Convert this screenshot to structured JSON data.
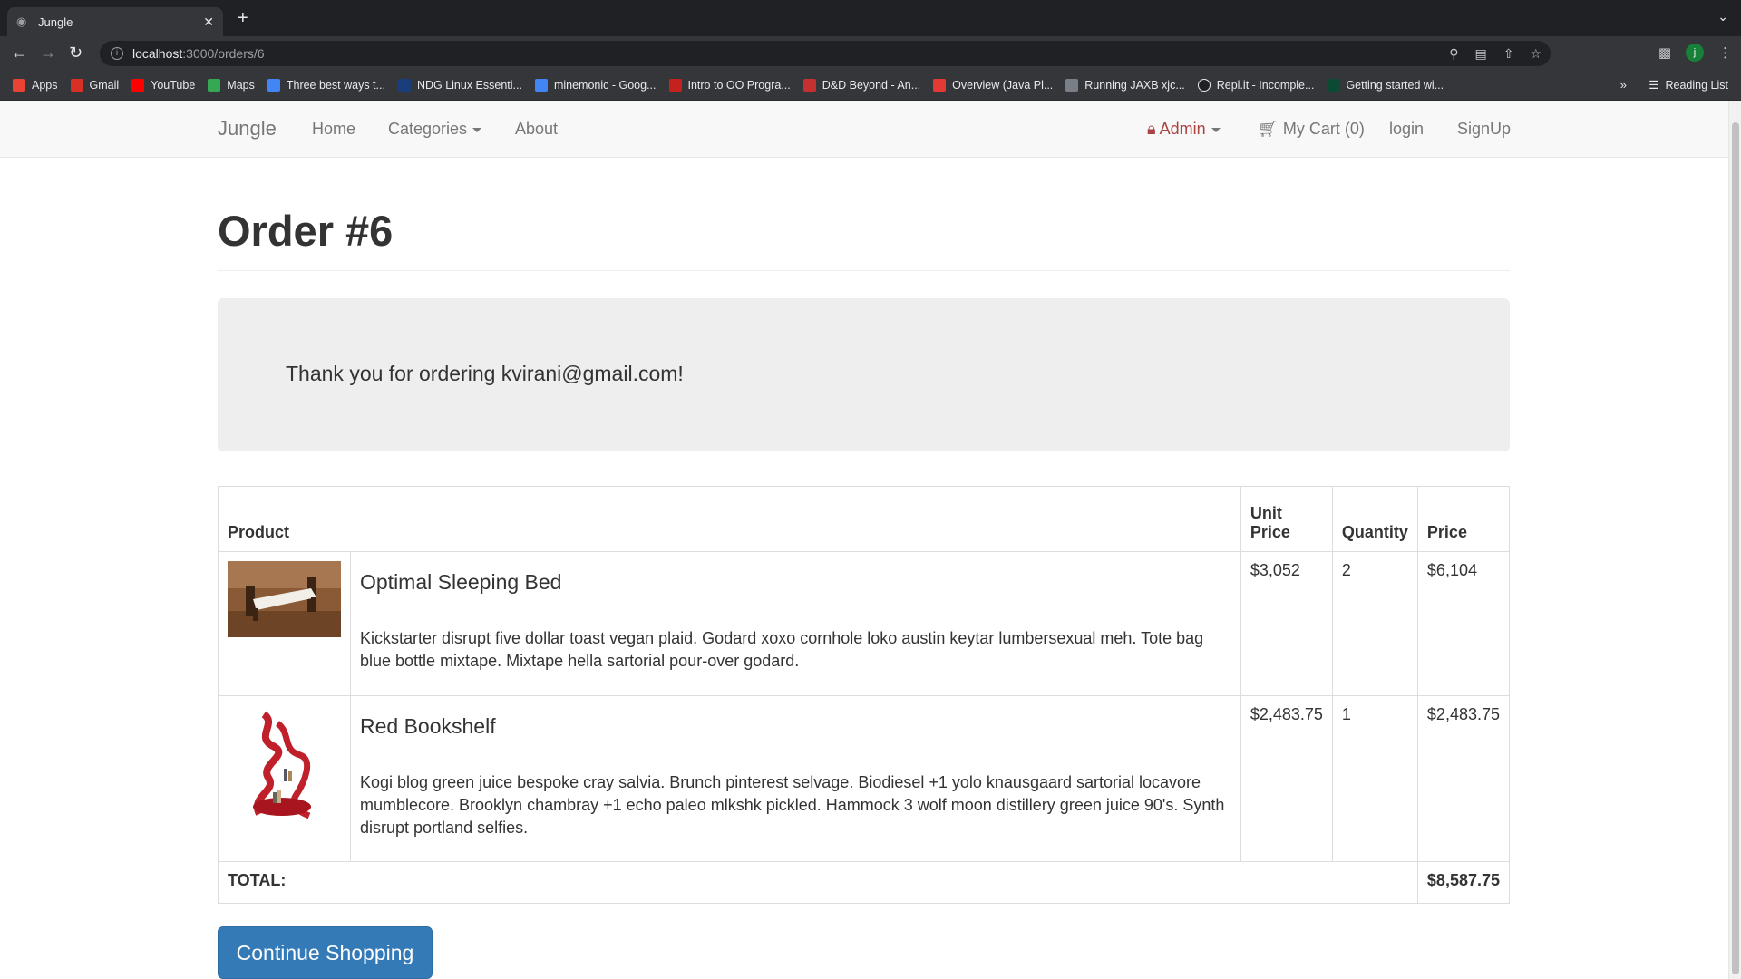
{
  "browser": {
    "tab_title": "Jungle",
    "url_host": "localhost",
    "url_path": ":3000/orders/6",
    "profile_initial": "j",
    "bookmarks": [
      {
        "label": "Apps",
        "icon": "apps-grid-icon",
        "color": "#ea4335"
      },
      {
        "label": "Gmail",
        "icon": "gmail-icon",
        "color": "#d93025"
      },
      {
        "label": "YouTube",
        "icon": "youtube-icon",
        "color": "#ff0000"
      },
      {
        "label": "Maps",
        "icon": "maps-icon",
        "color": "#34a853"
      },
      {
        "label": "Three best ways t...",
        "icon": "docs-icon",
        "color": "#4285f4"
      },
      {
        "label": "NDG Linux Essenti...",
        "icon": "ndg-icon",
        "color": "#1a3d7c"
      },
      {
        "label": "minemonic - Goog...",
        "icon": "docs-icon",
        "color": "#4285f4"
      },
      {
        "label": "Intro to OO Progra...",
        "icon": "course-icon",
        "color": "#c5221f"
      },
      {
        "label": "D&D Beyond - An...",
        "icon": "dndbeyond-icon",
        "color": "#c53131"
      },
      {
        "label": "Overview (Java Pl...",
        "icon": "oracle-icon",
        "color": "#e53935"
      },
      {
        "label": "Running JAXB xjc...",
        "icon": "globe-icon",
        "color": "#7a7f87"
      },
      {
        "label": "Repl.it - Incomple...",
        "icon": "replit-icon",
        "color": "#ffffff"
      },
      {
        "label": "Getting started wi...",
        "icon": "django-icon",
        "color": "#0c4b33"
      }
    ],
    "reading_list": "Reading List"
  },
  "navbar": {
    "brand": "Jungle",
    "home": "Home",
    "categories": "Categories",
    "about": "About",
    "admin": "Admin",
    "cart": "My Cart (0)",
    "login": "login",
    "signup": "SignUp"
  },
  "page": {
    "title": "Order #6",
    "thank_you": "Thank you for ordering kvirani@gmail.com!",
    "continue_button": "Continue Shopping"
  },
  "table": {
    "headers": {
      "product": "Product",
      "unit_price": "Unit Price",
      "quantity": "Quantity",
      "price": "Price"
    },
    "items": [
      {
        "name": "Optimal Sleeping Bed",
        "description": "Kickstarter disrupt five dollar toast vegan plaid. Godard xoxo cornhole loko austin keytar lumbersexual meh. Tote bag blue bottle mixtape. Mixtape hella sartorial pour-over godard.",
        "unit_price": "$3,052",
        "quantity": "2",
        "price": "$6,104",
        "image_icon": "bed-photo"
      },
      {
        "name": "Red Bookshelf",
        "description": "Kogi blog green juice bespoke cray salvia. Brunch pinterest selvage. Biodiesel +1 yolo knausgaard sartorial locavore mumblecore. Brooklyn chambray +1 echo paleo mlkshk pickled. Hammock 3 wolf moon distillery green juice 90's. Synth disrupt portland selfies.",
        "unit_price": "$2,483.75",
        "quantity": "1",
        "price": "$2,483.75",
        "image_icon": "bookshelf-photo"
      }
    ],
    "total_label": "TOTAL:",
    "total_value": "$8,587.75"
  },
  "colors": {
    "primary": "#337ab7",
    "admin": "#a94442",
    "jumbotron": "#eeeeee"
  }
}
